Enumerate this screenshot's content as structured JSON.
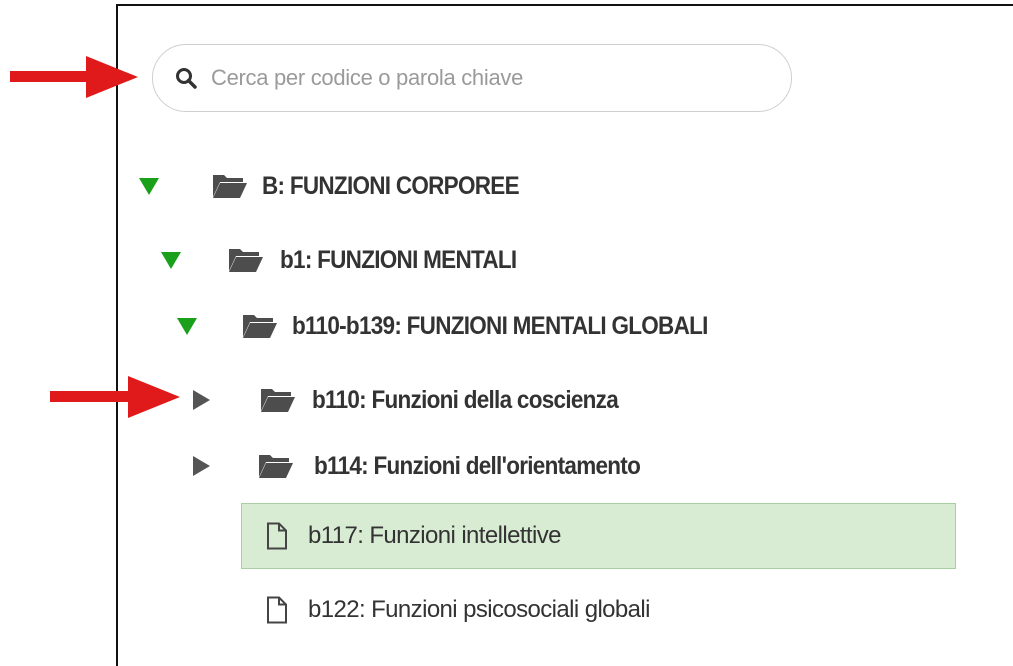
{
  "colors": {
    "expanded_triangle": "#1aa01a",
    "collapsed_triangle": "#555555",
    "folder": "#4d4d4d",
    "arrow": "#e01a1a",
    "selected_bg": "#d8ecd4"
  },
  "search": {
    "placeholder": "Cerca per codice o parola chiave",
    "value": ""
  },
  "tree": [
    {
      "label": "B: FUNZIONI CORPOREE",
      "icon": "folder-open-icon",
      "state": "expanded"
    },
    {
      "label": "b1: FUNZIONI MENTALI",
      "icon": "folder-open-icon",
      "state": "expanded"
    },
    {
      "label": "b110-b139: FUNZIONI MENTALI GLOBALI",
      "icon": "folder-open-icon",
      "state": "expanded"
    },
    {
      "label": "b110: Funzioni della coscienza",
      "icon": "folder-open-icon",
      "state": "collapsed"
    },
    {
      "label": "b114: Funzioni dell'orientamento",
      "icon": "folder-open-icon",
      "state": "collapsed"
    },
    {
      "label": "b117: Funzioni intellettive",
      "icon": "file-icon",
      "state": "leaf",
      "selected": true
    },
    {
      "label": "b122: Funzioni psicosociali globali",
      "icon": "file-icon",
      "state": "leaf"
    }
  ]
}
